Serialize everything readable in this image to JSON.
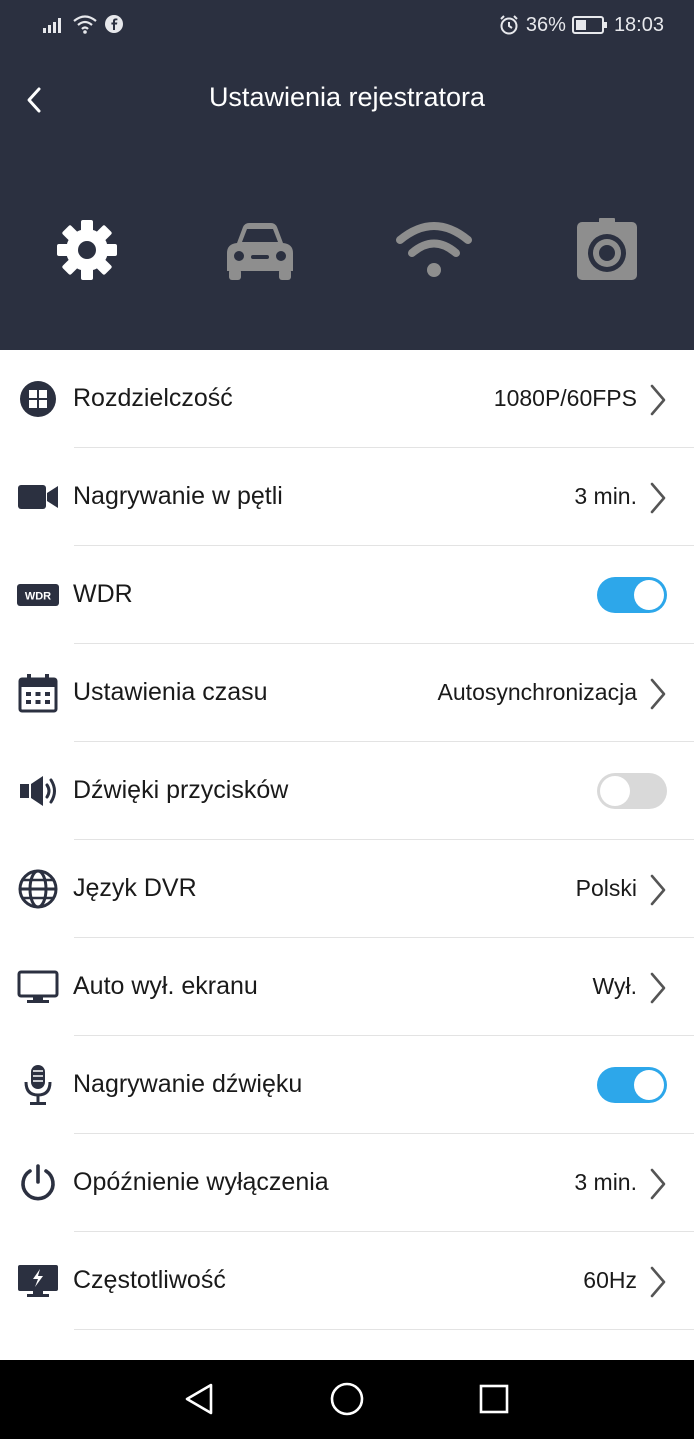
{
  "status": {
    "battery_percent": "36%",
    "time": "18:03"
  },
  "header": {
    "title": "Ustawienia rejestratora"
  },
  "tabs": [
    {
      "icon": "gear-icon",
      "active": true
    },
    {
      "icon": "car-icon",
      "active": false
    },
    {
      "icon": "wifi-icon",
      "active": false
    },
    {
      "icon": "camera-icon",
      "active": false
    }
  ],
  "settings": {
    "items": [
      {
        "label": "Rozdzielczość",
        "value": "1080P/60FPS",
        "type": "chevron",
        "icon": "grid-icon"
      },
      {
        "label": "Nagrywanie w pętli",
        "value": "3 min.",
        "type": "chevron",
        "icon": "video-camera-icon"
      },
      {
        "label": "WDR",
        "type": "toggle",
        "on": true,
        "icon": "wdr-icon",
        "icon_text": "WDR"
      },
      {
        "label": "Ustawienia czasu",
        "value": "Autosynchronizacja",
        "type": "chevron",
        "icon": "calendar-icon"
      },
      {
        "label": "Dźwięki przycisków",
        "type": "toggle",
        "on": false,
        "icon": "speaker-icon"
      },
      {
        "label": "Język DVR",
        "value": "Polski",
        "type": "chevron",
        "icon": "globe-icon"
      },
      {
        "label": "Auto wył. ekranu",
        "value": "Wył.",
        "type": "chevron",
        "icon": "monitor-icon"
      },
      {
        "label": "Nagrywanie dźwięku",
        "type": "toggle",
        "on": true,
        "icon": "microphone-icon"
      },
      {
        "label": "Opóźnienie wyłączenia",
        "value": "3 min.",
        "type": "chevron",
        "icon": "power-icon"
      },
      {
        "label": "Częstotliwość",
        "value": "60Hz",
        "type": "chevron",
        "icon": "display-flash-icon"
      }
    ]
  },
  "colors": {
    "header_bg": "#2b3040",
    "toggle_on": "#2da7ea",
    "toggle_off": "#d9d9d9",
    "icon_dark": "#2b3040",
    "tab_inactive": "#8e8e8e"
  }
}
